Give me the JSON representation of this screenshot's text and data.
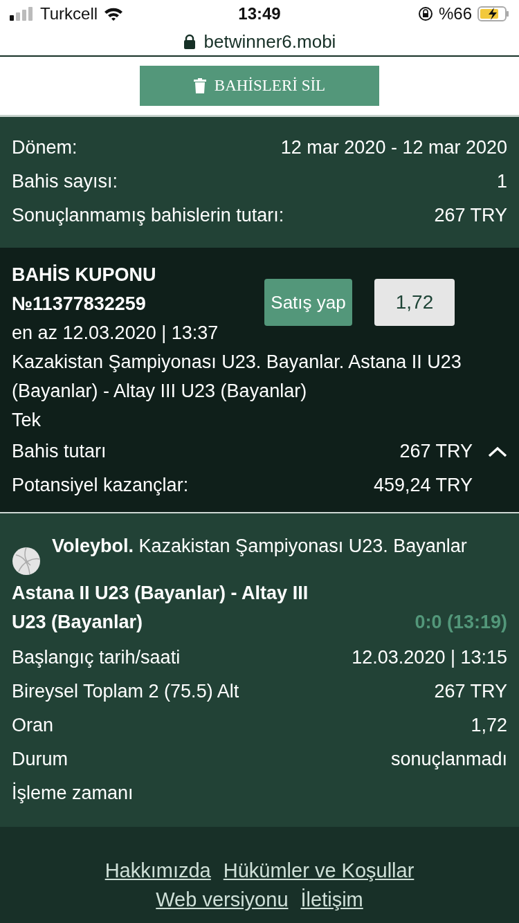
{
  "status_bar": {
    "carrier": "Turkcell",
    "time": "13:49",
    "battery": "%66"
  },
  "browser": {
    "url": "betwinner6.mobi"
  },
  "delete_button": {
    "label": "BAHİSLERİ SİL"
  },
  "summary": [
    {
      "label": "Dönem:",
      "value": "12 mar 2020 - 12 mar 2020"
    },
    {
      "label": "Bahis sayısı:",
      "value": "1"
    },
    {
      "label": "Sonuçlanmamış bahislerin tutarı:",
      "value": "267 TRY"
    }
  ],
  "coupon": {
    "title": "BAHİS KUPONU",
    "number": "№11377832259",
    "date": "en az 12.03.2020 | 13:37",
    "sell_button": "Satış yap",
    "odds": "1,72",
    "description": "Kazakistan Şampiyonası U23. Bayanlar. Astana II U23 (Bayanlar) - Altay III U23 (Bayanlar)",
    "type": "Tek",
    "expanded": true,
    "rows": [
      {
        "label": "Bahis tutarı",
        "value": "267 TRY"
      },
      {
        "label": "Potansiyel kazançlar:",
        "value": "459,24 TRY"
      }
    ]
  },
  "bet": {
    "sport": "Voleybol.",
    "league": "Kazakistan Şampiyonası U23. Bayanlar",
    "match": "Astana II U23 (Bayanlar) - Altay III U23 (Bayanlar)",
    "score": "0:0 (13:19)",
    "rows": [
      {
        "label": "Başlangıç tarih/saati",
        "value": "12.03.2020 | 13:15"
      },
      {
        "label": "Bireysel Toplam 2 (75.5) Alt",
        "value": "267 TRY"
      },
      {
        "label": "Oran",
        "value": "1,72"
      },
      {
        "label": "Durum",
        "value": "sonuçlanmadı"
      },
      {
        "label": "İşleme zamanı"
      }
    ]
  },
  "footer": {
    "links": [
      "Hakkımızda",
      "Hükümler ve Koşullar",
      "Web versiyonu",
      "İletişim"
    ]
  }
}
